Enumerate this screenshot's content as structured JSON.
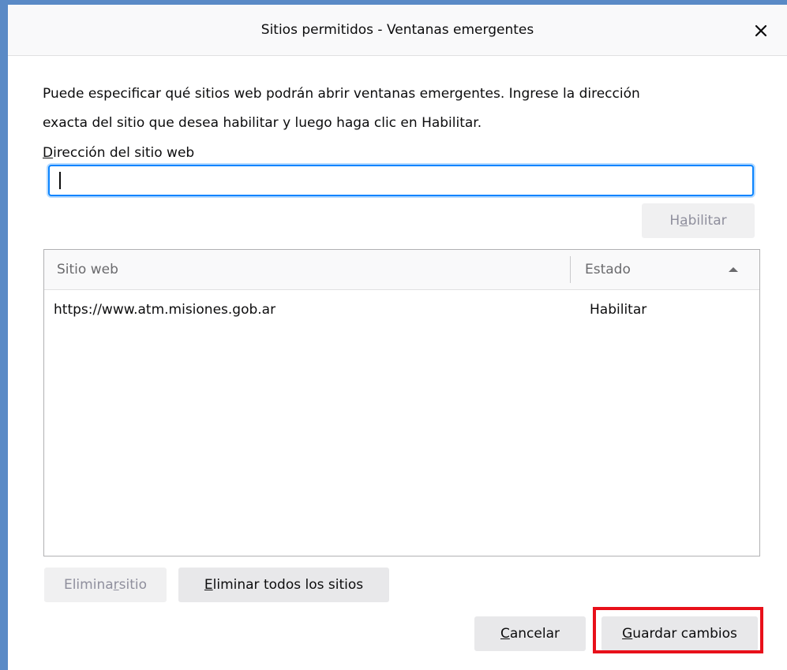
{
  "dialog": {
    "title": "Sitios permitidos - Ventanas emergentes",
    "close_icon": "close-icon",
    "description_line1": "Puede especificar qué sitios web podrán abrir ventanas emergentes. Ingrese la dirección",
    "description_line2": "exacta del sitio que desea habilitar y luego haga clic en Habilitar."
  },
  "address_field": {
    "label_key": "D",
    "label_rest": "irección del sitio web",
    "value": "",
    "placeholder": ""
  },
  "buttons": {
    "habilitar": {
      "pre": "H",
      "key": "a",
      "post": "bilitar",
      "enabled": false
    },
    "eliminar_sitio": {
      "pre": "Elimina",
      "key": "r",
      "post": " sitio",
      "enabled": false
    },
    "eliminar_todos": {
      "pre": "",
      "key": "E",
      "post": "liminar todos los sitios",
      "enabled": true
    },
    "cancelar": {
      "pre": "",
      "key": "C",
      "post": "ancelar",
      "enabled": true
    },
    "guardar": {
      "pre": "",
      "key": "G",
      "post": "uardar cambios",
      "enabled": true
    }
  },
  "table": {
    "columns": [
      "Sitio web",
      "Estado"
    ],
    "sort_icon": "sort-ascending-icon",
    "rows": [
      {
        "site": "https://www.atm.misiones.gob.ar",
        "status": "Habilitar"
      }
    ]
  },
  "colors": {
    "focus_ring": "#0a84ff",
    "highlight_box": "#e8101a",
    "window_frame": "#5a8ac6"
  }
}
